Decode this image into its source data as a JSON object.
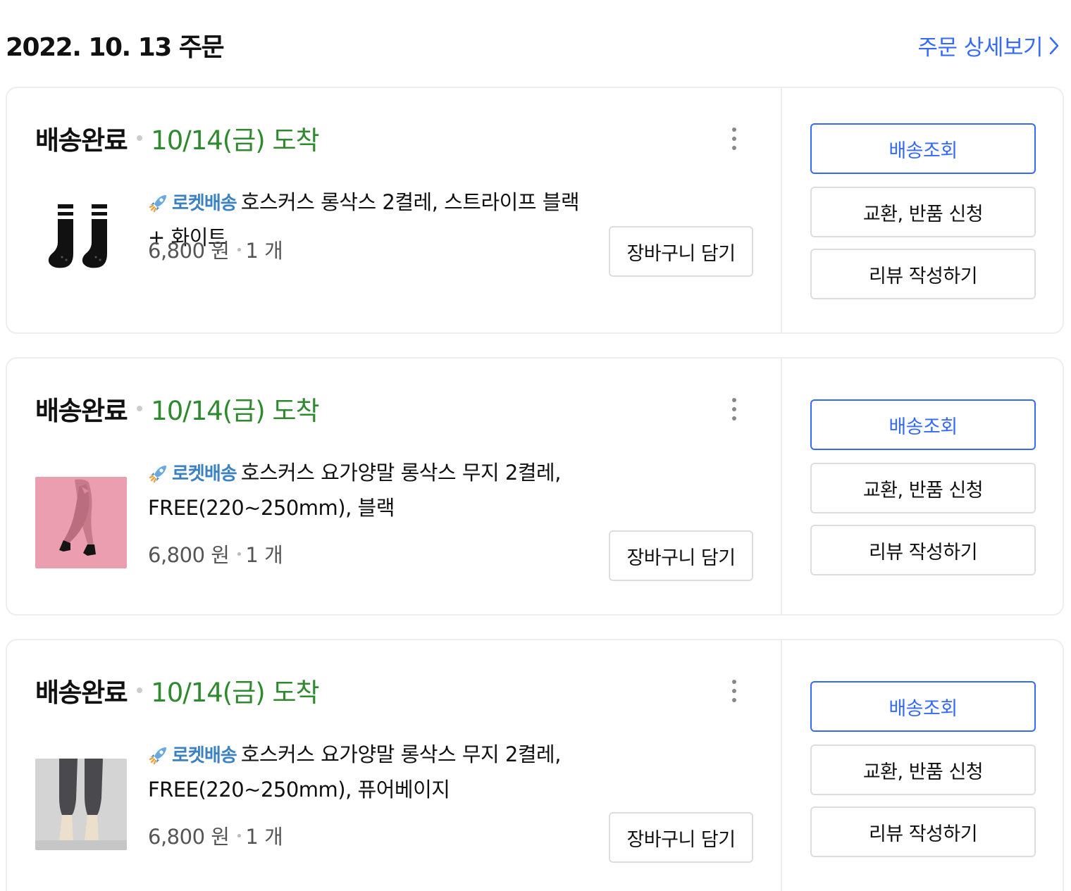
{
  "order": {
    "date_label": "2022. 10. 13 주문",
    "detail_link_label": "주문 상세보기",
    "colors": {
      "accent": "#346aff",
      "arrival": "#2f8a2f",
      "rocket": "#3b82c4"
    }
  },
  "items": [
    {
      "status": "배송완료",
      "arrival": "10/14(금) 도착",
      "rocket_label": "로켓배송",
      "title_lines": [
        "호스커스 롱삭스 2켤레, 스트라이프 블랙 + 화이트"
      ],
      "price": "6,800 원",
      "qty": "1 개",
      "cart_label": "장바구니 담기",
      "thumb": "black-striped-socks-image",
      "actions": {
        "track": "배송조회",
        "return": "교환, 반품 신청",
        "review": "리뷰 작성하기"
      }
    },
    {
      "status": "배송완료",
      "arrival": "10/14(금) 도착",
      "rocket_label": "로켓배송",
      "title_lines": [
        "호스커스 요가양말 롱삭스 무지 2켤레,",
        "FREE(220~250mm), 블랙"
      ],
      "price": "6,800 원",
      "qty": "1 개",
      "cart_label": "장바구니 담기",
      "thumb": "pink-background-yoga-socks-image",
      "actions": {
        "track": "배송조회",
        "return": "교환, 반품 신청",
        "review": "리뷰 작성하기"
      }
    },
    {
      "status": "배송완료",
      "arrival": "10/14(금) 도착",
      "rocket_label": "로켓배송",
      "title_lines": [
        "호스커스 요가양말 롱삭스 무지 2켤레,",
        "FREE(220~250mm), 퓨어베이지"
      ],
      "price": "6,800 원",
      "qty": "1 개",
      "cart_label": "장바구니 담기",
      "thumb": "beige-yoga-socks-image",
      "actions": {
        "track": "배송조회",
        "return": "교환, 반품 신청",
        "review": "리뷰 작성하기"
      }
    }
  ]
}
